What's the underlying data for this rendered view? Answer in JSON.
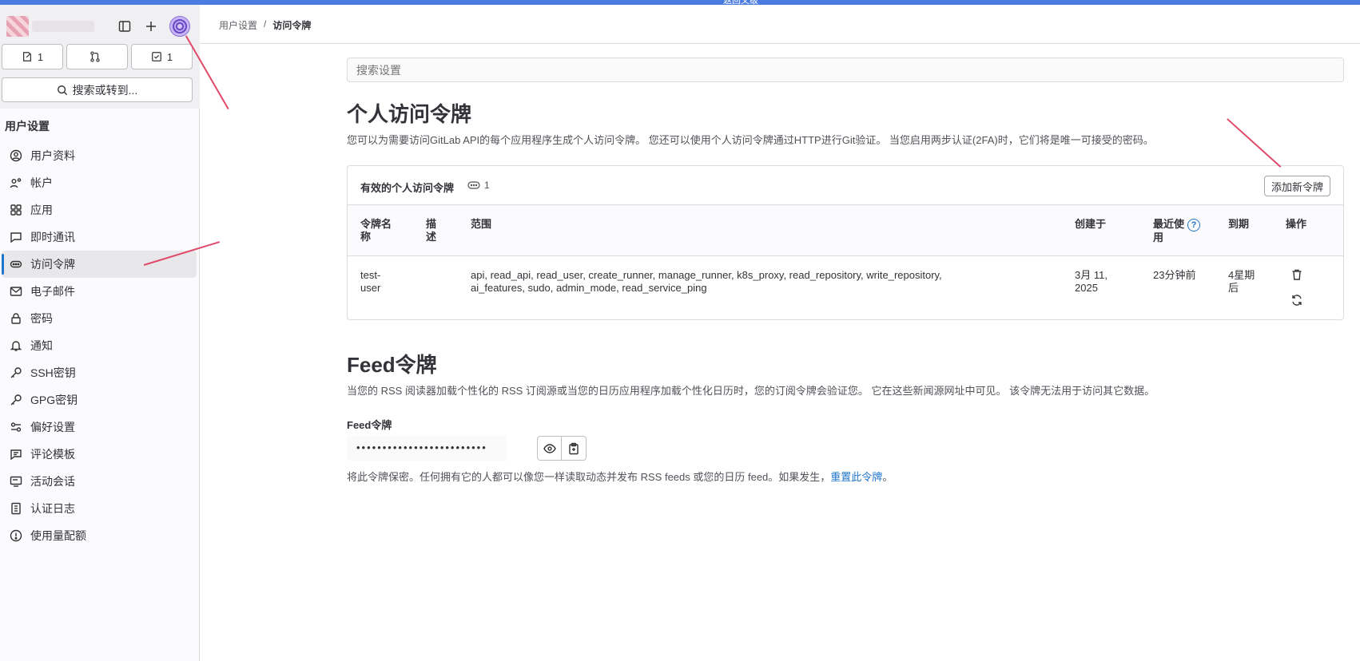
{
  "topbar": {
    "label": "返回父级"
  },
  "sidebar": {
    "counts": [
      {
        "icon": "issues-icon",
        "value": "1"
      },
      {
        "icon": "merge-request-icon",
        "value": ""
      },
      {
        "icon": "todo-icon",
        "value": "1"
      }
    ],
    "search_label": "搜索或转到...",
    "section_title": "用户设置",
    "items": [
      {
        "label": "用户资料",
        "icon": "profile-icon"
      },
      {
        "label": "帐户",
        "icon": "account-icon"
      },
      {
        "label": "应用",
        "icon": "applications-icon"
      },
      {
        "label": "即时通讯",
        "icon": "chat-icon"
      },
      {
        "label": "访问令牌",
        "icon": "token-icon",
        "active": true
      },
      {
        "label": "电子邮件",
        "icon": "email-icon"
      },
      {
        "label": "密码",
        "icon": "lock-icon"
      },
      {
        "label": "通知",
        "icon": "bell-icon"
      },
      {
        "label": "SSH密钥",
        "icon": "key-icon"
      },
      {
        "label": "GPG密钥",
        "icon": "key-icon"
      },
      {
        "label": "偏好设置",
        "icon": "preferences-icon"
      },
      {
        "label": "评论模板",
        "icon": "comment-template-icon"
      },
      {
        "label": "活动会话",
        "icon": "monitor-icon"
      },
      {
        "label": "认证日志",
        "icon": "log-icon"
      },
      {
        "label": "使用量配额",
        "icon": "quota-icon"
      }
    ]
  },
  "breadcrumb": {
    "parent": "用户设置",
    "separator": "/",
    "current": "访问令牌"
  },
  "search": {
    "placeholder": "搜索设置"
  },
  "pat": {
    "title": "个人访问令牌",
    "description": "您可以为需要访问GitLab API的每个应用程序生成个人访问令牌。 您还可以使用个人访问令牌通过HTTP进行Git验证。 当您启用两步认证(2FA)时，它们将是唯一可接受的密码。",
    "card_title": "有效的个人访问令牌",
    "count": "1",
    "add_button": "添加新令牌",
    "columns": {
      "name": [
        "令牌名",
        "称"
      ],
      "desc": [
        "描",
        "述"
      ],
      "scopes": "范围",
      "created": "创建于",
      "last_used": [
        "最近使",
        "用"
      ],
      "expires": "到期",
      "actions": "操作"
    },
    "row": {
      "name": [
        "test-",
        "user"
      ],
      "scopes": [
        "api, read_api, read_user, create_runner, manage_runner, k8s_proxy, read_repository, write_repository,",
        "ai_features, sudo, admin_mode, read_service_ping"
      ],
      "created": [
        "3月 11,",
        "2025"
      ],
      "last_used": "23分钟前",
      "expires": [
        "4星期",
        "后"
      ]
    }
  },
  "feed": {
    "title": "Feed令牌",
    "description": "当您的 RSS 阅读器加载个性化的 RSS 订阅源或当您的日历应用程序加载个性化日历时，您的订阅令牌会验证您。 它在这些新闻源网址中可见。 该令牌无法用于访问其它数据。",
    "label": "Feed令牌",
    "masked": "•••••••••••••••••••••••••",
    "note": "将此令牌保密。任何拥有它的人都可以像您一样读取动态并发布 RSS feeds 或您的日历 feed。如果发生，",
    "reset_link": "重置此令牌",
    "note_end": "。"
  },
  "colors": {
    "accent": "#1f75cb",
    "annotation": "#e04a6a",
    "topbar": "#4a7be0"
  }
}
